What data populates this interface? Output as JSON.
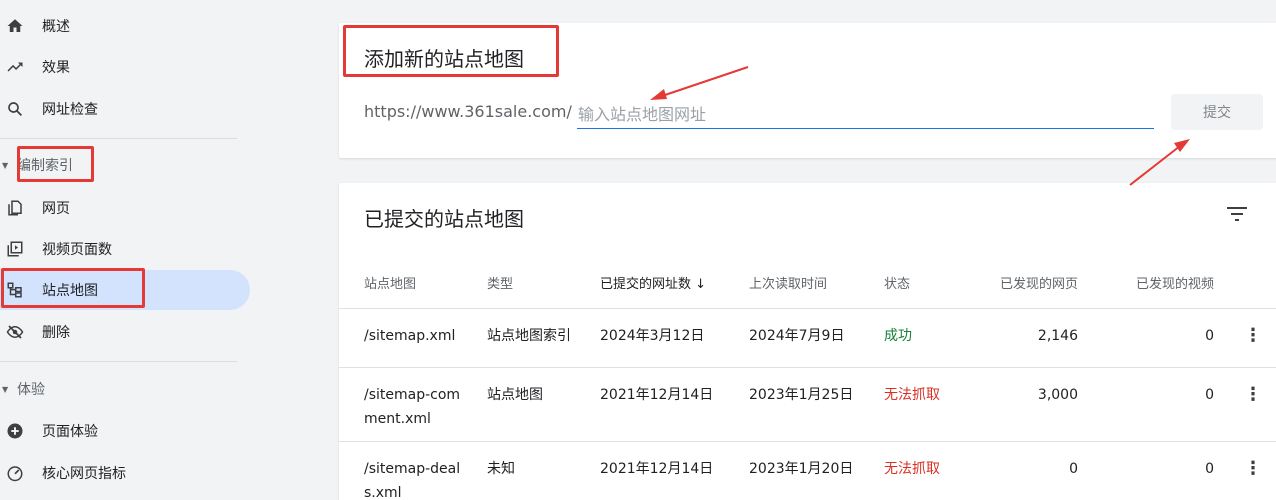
{
  "sidebar": {
    "items_top": [
      {
        "label": "概述",
        "icon": "home-icon"
      },
      {
        "label": "效果",
        "icon": "trending-up-icon"
      },
      {
        "label": "网址检查",
        "icon": "search-icon"
      }
    ],
    "section_index": {
      "label": "编制索引",
      "items": [
        {
          "label": "网页",
          "icon": "pages-icon"
        },
        {
          "label": "视频页面数",
          "icon": "video-pages-icon"
        },
        {
          "label": "站点地图",
          "icon": "sitemap-icon",
          "active": true
        },
        {
          "label": "删除",
          "icon": "visibility-off-icon"
        }
      ]
    },
    "section_experience": {
      "label": "体验",
      "items": [
        {
          "label": "页面体验",
          "icon": "add-circle-icon"
        },
        {
          "label": "核心网页指标",
          "icon": "speed-gauge-icon"
        }
      ]
    }
  },
  "add_sitemap": {
    "title": "添加新的站点地图",
    "url_prefix": "https://www.361sale.com/",
    "input_placeholder": "输入站点地图网址",
    "submit_label": "提交"
  },
  "submitted": {
    "title": "已提交的站点地图",
    "columns": [
      "站点地图",
      "类型",
      "已提交的网址数",
      "上次读取时间",
      "状态",
      "已发现的网页",
      "已发现的视频"
    ],
    "sort_indicator": "↓",
    "rows": [
      {
        "sitemap": "/sitemap.xml",
        "type": "站点地图索引",
        "submitted": "2024年3月12日",
        "last_read": "2024年7月9日",
        "status": "成功",
        "status_kind": "ok",
        "pages": "2,146",
        "videos": "0"
      },
      {
        "sitemap": "/sitemap-comment.xml",
        "type": "站点地图",
        "submitted": "2021年12月14日",
        "last_read": "2023年1月25日",
        "status": "无法抓取",
        "status_kind": "error",
        "pages": "3,000",
        "videos": "0"
      },
      {
        "sitemap": "/sitemap-deals.xml",
        "type": "未知",
        "submitted": "2021年12月14日",
        "last_read": "2023年1月20日",
        "status": "无法抓取",
        "status_kind": "error",
        "pages": "0",
        "videos": "0"
      }
    ]
  },
  "colors": {
    "accent": "#1a73e8",
    "success": "#188038",
    "error": "#d93025",
    "annotation": "#e53935",
    "active_nav": "#d3e3fd"
  }
}
